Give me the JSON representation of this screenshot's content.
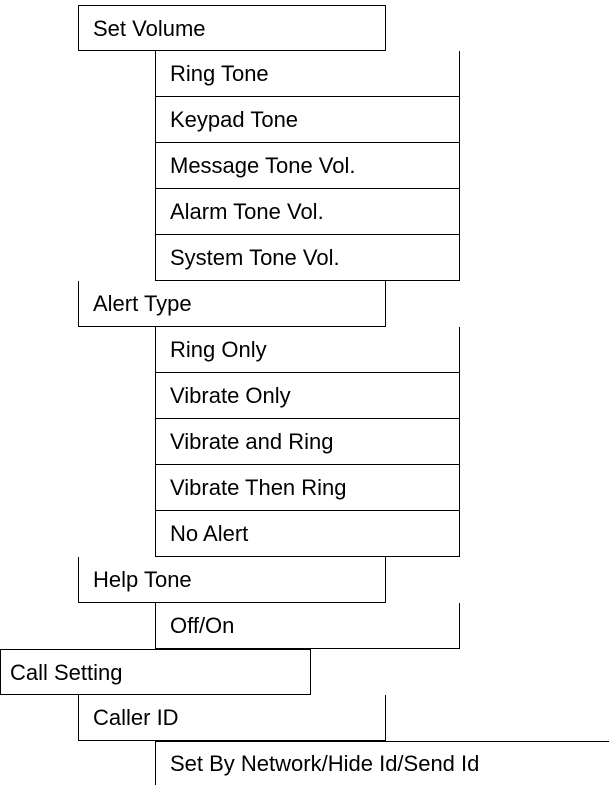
{
  "menu": {
    "set_volume": {
      "label": "Set Volume",
      "items": [
        "Ring Tone",
        "Keypad Tone",
        "Message Tone Vol.",
        "Alarm Tone Vol.",
        "System Tone Vol."
      ]
    },
    "alert_type": {
      "label": "Alert Type",
      "items": [
        "Ring Only",
        "Vibrate Only",
        "Vibrate and Ring",
        "Vibrate Then Ring",
        "No Alert"
      ]
    },
    "help_tone": {
      "label": "Help Tone",
      "items": [
        "Off/On"
      ]
    },
    "call_setting": {
      "label": "Call Setting"
    },
    "caller_id": {
      "label": "Caller ID",
      "items": [
        "Set By Network/Hide Id/Send Id"
      ]
    }
  }
}
